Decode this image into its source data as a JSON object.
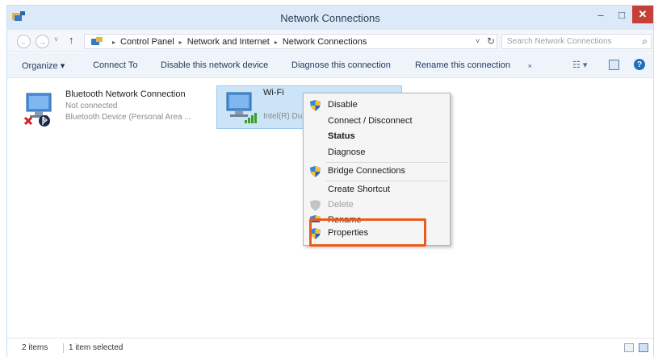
{
  "window": {
    "title": "Network Connections",
    "min_glyph": "–",
    "max_glyph": "□",
    "close_glyph": "✕"
  },
  "address": {
    "back_glyph": "←",
    "forward_glyph": "→",
    "history_glyph": "˅",
    "up_glyph": "↑",
    "breadcrumbs": [
      "Control Panel",
      "Network and Internet",
      "Network Connections"
    ],
    "separator_glyph": "▸",
    "dropdown_glyph": "˅",
    "refresh_glyph": "↻",
    "search_placeholder": "Search Network Connections",
    "search_glyph": "⌕"
  },
  "toolbar": {
    "organize": "Organize ▾",
    "connect": "Connect To",
    "disable": "Disable this network device",
    "diagnose": "Diagnose this connection",
    "rename": "Rename this connection",
    "more": "»",
    "views_glyph": "☷ ▾",
    "help": "?"
  },
  "connections": [
    {
      "name": "Bluetooth Network Connection",
      "status": "Not connected",
      "device": "Bluetooth Device (Personal Area ..."
    },
    {
      "name": "Wi-Fi",
      "device": "Intel(R) Dua"
    }
  ],
  "context_menu": {
    "items": [
      {
        "label": "Disable"
      },
      {
        "label": "Connect / Disconnect"
      },
      {
        "label": "Status"
      },
      {
        "label": "Diagnose"
      },
      {
        "label": "Bridge Connections"
      },
      {
        "label": "Create Shortcut"
      },
      {
        "label": "Delete"
      },
      {
        "label": "Rename"
      },
      {
        "label": "Properties"
      }
    ]
  },
  "statusbar": {
    "count": "2 items",
    "selected": "1 item selected"
  },
  "colors": {
    "highlight_border": "#ec5b1e",
    "selection_fill": "#cce4f7",
    "close_button": "#c6403a"
  }
}
